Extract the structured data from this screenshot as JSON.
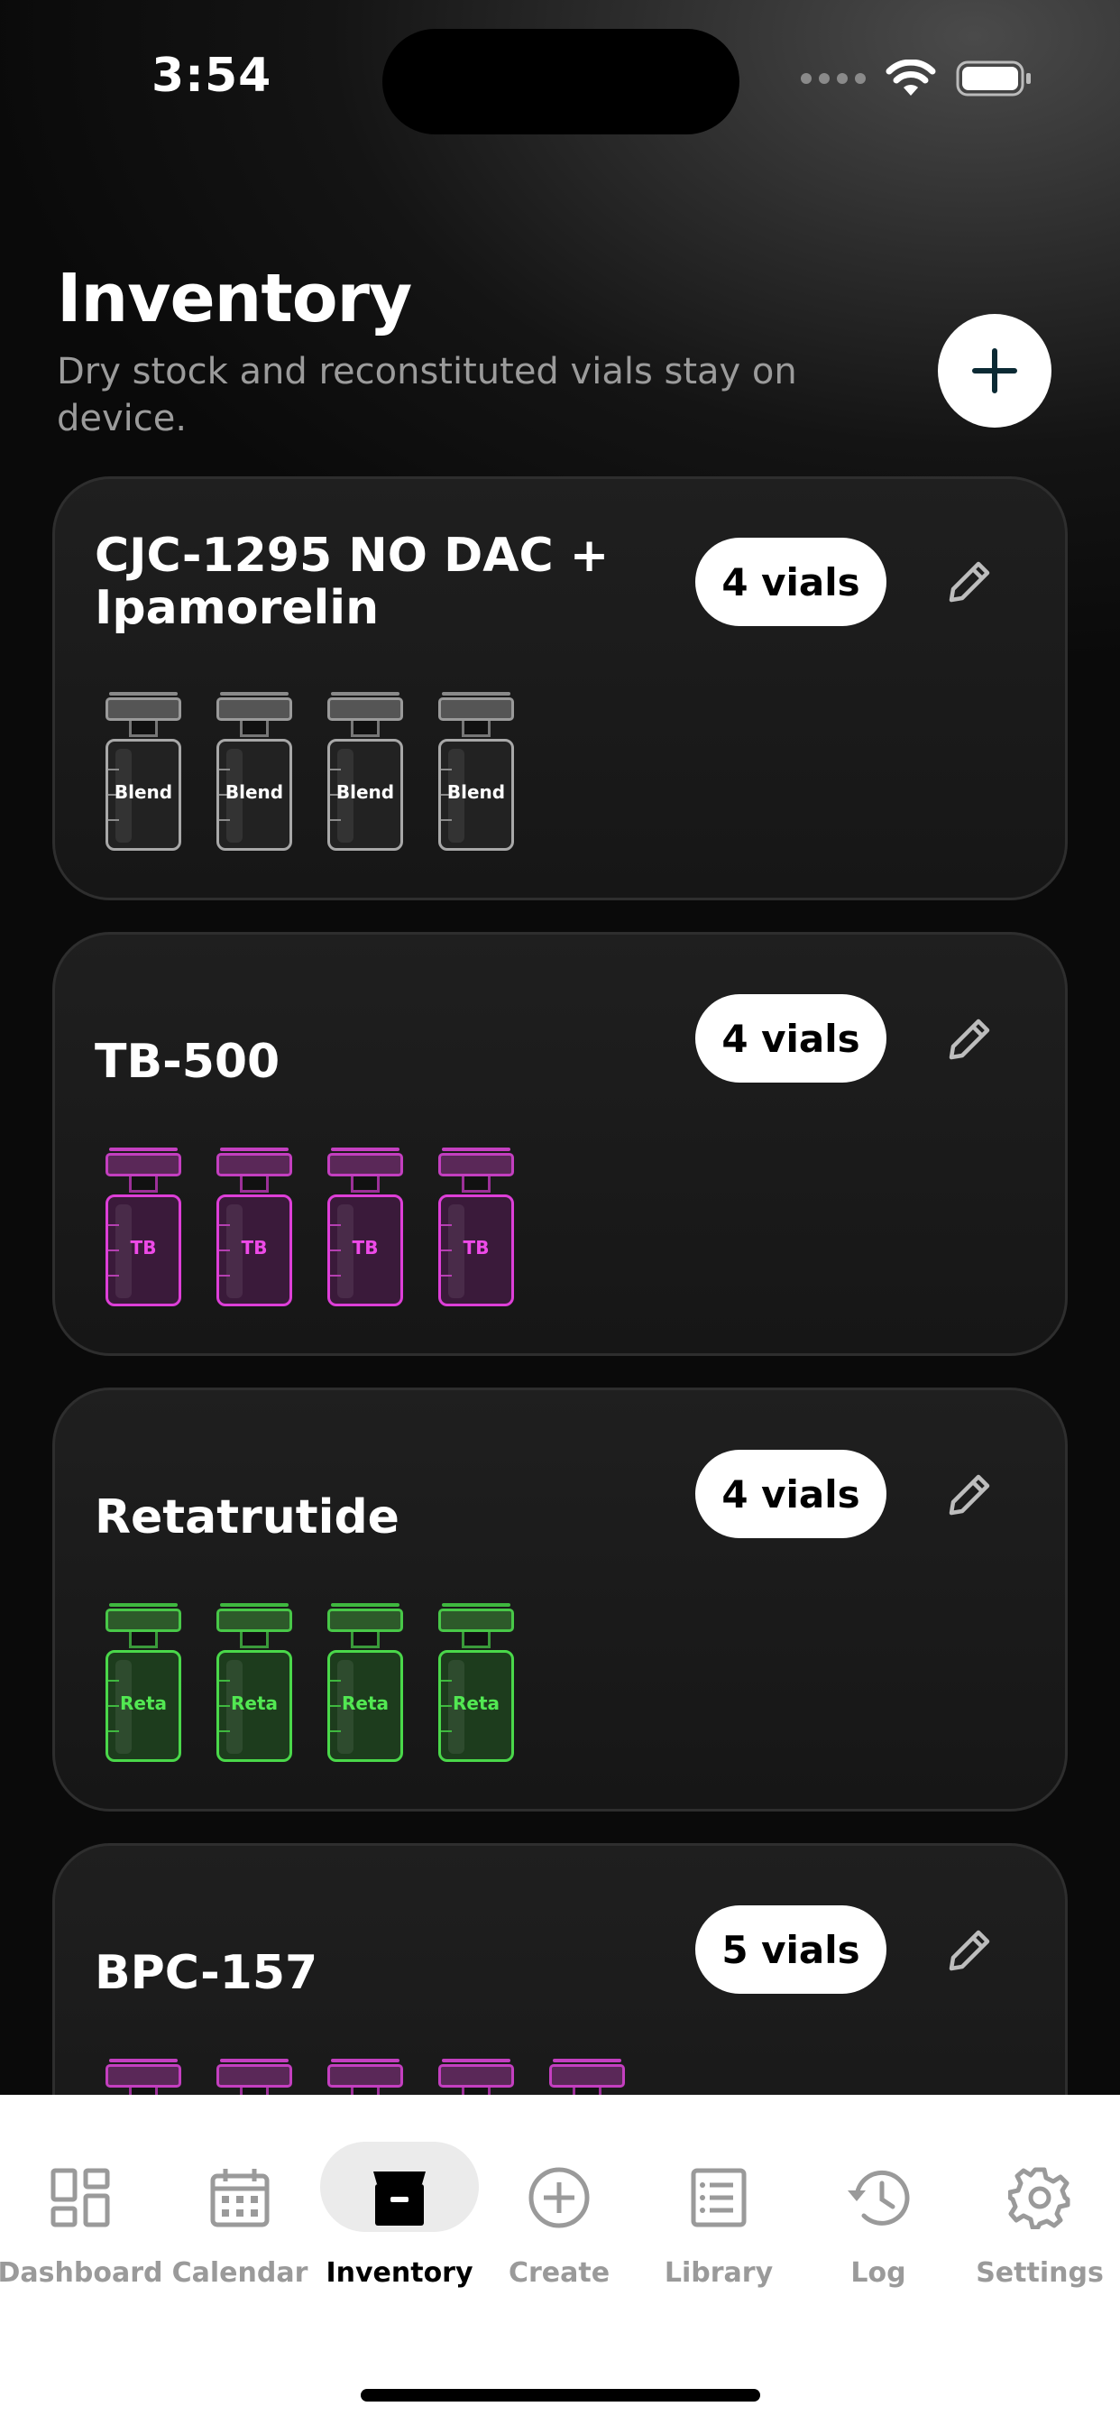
{
  "status_bar": {
    "time": "3:54"
  },
  "header": {
    "title": "Inventory",
    "subtitle": "Dry stock and reconstituted vials stay on device."
  },
  "items": [
    {
      "name": "CJC-1295 NO DAC + Ipamorelin",
      "badge": "4 vials",
      "vial_count": 4,
      "vial_label": "Blend",
      "color": "#a8a8a8"
    },
    {
      "name": "TB-500",
      "badge": "4 vials",
      "vial_count": 4,
      "vial_label": "TB",
      "color": "#de3fd8"
    },
    {
      "name": "Retatrutide",
      "badge": "4 vials",
      "vial_count": 4,
      "vial_label": "Reta",
      "color": "#4ad84a"
    },
    {
      "name": "BPC-157",
      "badge": "5 vials",
      "vial_count": 5,
      "vial_label": "",
      "color": "#de3fd8"
    }
  ],
  "tabs": [
    {
      "label": "Dashboard",
      "icon": "dashboard-icon",
      "active": false
    },
    {
      "label": "Calendar",
      "icon": "calendar-icon",
      "active": false
    },
    {
      "label": "Inventory",
      "icon": "archive-box-icon",
      "active": true
    },
    {
      "label": "Create",
      "icon": "plus-circle-icon",
      "active": false
    },
    {
      "label": "Library",
      "icon": "list-icon",
      "active": false
    },
    {
      "label": "Log",
      "icon": "history-icon",
      "active": false
    },
    {
      "label": "Settings",
      "icon": "gear-icon",
      "active": false
    }
  ]
}
